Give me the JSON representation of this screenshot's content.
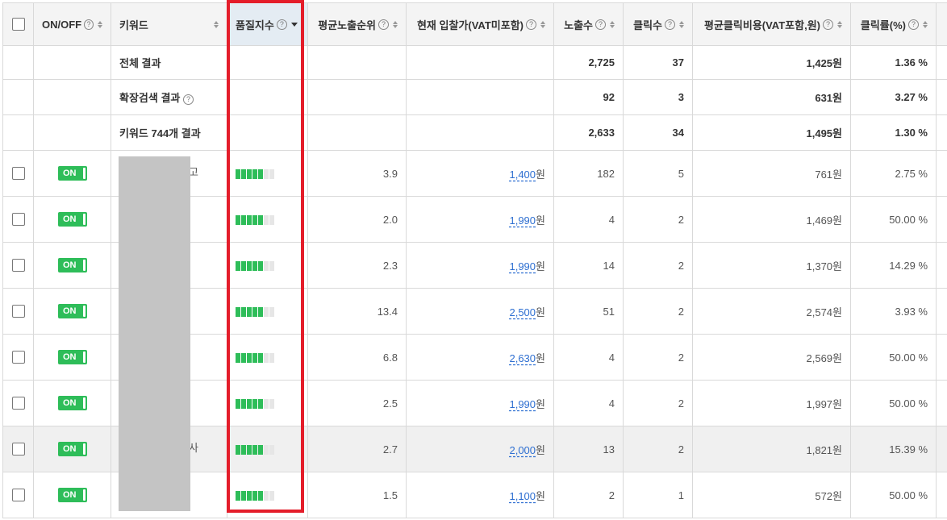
{
  "headers": {
    "onoff": "ON/OFF",
    "keyword": "키워드",
    "quality": "품질지수",
    "avg_rank": "평균노출순위",
    "bid": "현재 입찰가(VAT미포함)",
    "impressions": "노출수",
    "clicks": "클릭수",
    "avg_cpc": "평균클릭비용(VAT포함,원)",
    "ctr": "클릭률(%)"
  },
  "summary": [
    {
      "label": "전체 결과",
      "impressions": "2,725",
      "clicks": "37",
      "avg_cpc": "1,425원",
      "ctr": "1.36 %"
    },
    {
      "label": "확장검색 결과",
      "impressions": "92",
      "clicks": "3",
      "avg_cpc": "631원",
      "ctr": "3.27 %"
    },
    {
      "label": "키워드 744개 결과",
      "impressions": "2,633",
      "clicks": "34",
      "avg_cpc": "1,495원",
      "ctr": "1.30 %"
    }
  ],
  "toggle_label": "ON",
  "quality_max": 7,
  "rows": [
    {
      "keyword_tail": "고",
      "quality": 5,
      "avg_rank": "3.9",
      "bid": "1,400",
      "bid_unit": "원",
      "impressions": "182",
      "clicks": "5",
      "avg_cpc": "761원",
      "ctr": "2.75 %"
    },
    {
      "keyword_tail": "",
      "quality": 5,
      "avg_rank": "2.0",
      "bid": "1,990",
      "bid_unit": "원",
      "impressions": "4",
      "clicks": "2",
      "avg_cpc": "1,469원",
      "ctr": "50.00 %"
    },
    {
      "keyword_tail": "",
      "quality": 5,
      "avg_rank": "2.3",
      "bid": "1,990",
      "bid_unit": "원",
      "impressions": "14",
      "clicks": "2",
      "avg_cpc": "1,370원",
      "ctr": "14.29 %"
    },
    {
      "keyword_tail": "",
      "quality": 5,
      "avg_rank": "13.4",
      "bid": "2,500",
      "bid_unit": "원",
      "impressions": "51",
      "clicks": "2",
      "avg_cpc": "2,574원",
      "ctr": "3.93 %"
    },
    {
      "keyword_tail": "",
      "quality": 5,
      "avg_rank": "6.8",
      "bid": "2,630",
      "bid_unit": "원",
      "impressions": "4",
      "clicks": "2",
      "avg_cpc": "2,569원",
      "ctr": "50.00 %"
    },
    {
      "keyword_tail": "",
      "quality": 5,
      "avg_rank": "2.5",
      "bid": "1,990",
      "bid_unit": "원",
      "impressions": "4",
      "clicks": "2",
      "avg_cpc": "1,997원",
      "ctr": "50.00 %"
    },
    {
      "keyword_tail": "사",
      "quality": 5,
      "avg_rank": "2.7",
      "bid": "2,000",
      "bid_unit": "원",
      "impressions": "13",
      "clicks": "2",
      "avg_cpc": "1,821원",
      "ctr": "15.39 %",
      "highlight": true
    },
    {
      "keyword_tail": "",
      "quality": 5,
      "avg_rank": "1.5",
      "bid": "1,100",
      "bid_unit": "원",
      "impressions": "2",
      "clicks": "1",
      "avg_cpc": "572원",
      "ctr": "50.00 %"
    }
  ],
  "colors": {
    "toggle_on": "#2ebd59",
    "quality_on": "#2ebd59",
    "highlight_box": "#e41d2a",
    "link": "#2e6fd1"
  }
}
